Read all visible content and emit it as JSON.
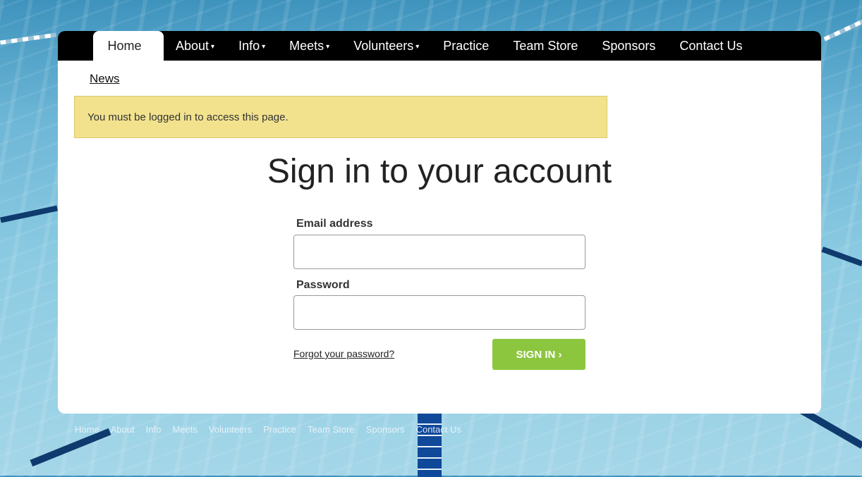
{
  "nav": {
    "items": [
      {
        "label": "Home",
        "dropdown": false,
        "active": true
      },
      {
        "label": "About",
        "dropdown": true
      },
      {
        "label": "Info",
        "dropdown": true
      },
      {
        "label": "Meets",
        "dropdown": true
      },
      {
        "label": "Volunteers",
        "dropdown": true
      },
      {
        "label": "Practice",
        "dropdown": false
      },
      {
        "label": "Team Store",
        "dropdown": false
      },
      {
        "label": "Sponsors",
        "dropdown": false
      },
      {
        "label": "Contact Us",
        "dropdown": false
      }
    ],
    "caret_glyph": "▾"
  },
  "breadcrumb": {
    "news_label": "News"
  },
  "alert": {
    "message": "You must be logged in to access this page.",
    "color": "#f2e28e"
  },
  "signin": {
    "title": "Sign in to your account",
    "email_label": "Email address",
    "email_value": "",
    "password_label": "Password",
    "password_value": "",
    "forgot_label": "Forgot your password?",
    "submit_label": "SIGN IN ›",
    "submit_color": "#8cc63f"
  },
  "footer": {
    "links": [
      "Home",
      "About",
      "Info",
      "Meets",
      "Volunteers",
      "Practice",
      "Team Store",
      "Sponsors",
      "Contact Us"
    ]
  }
}
